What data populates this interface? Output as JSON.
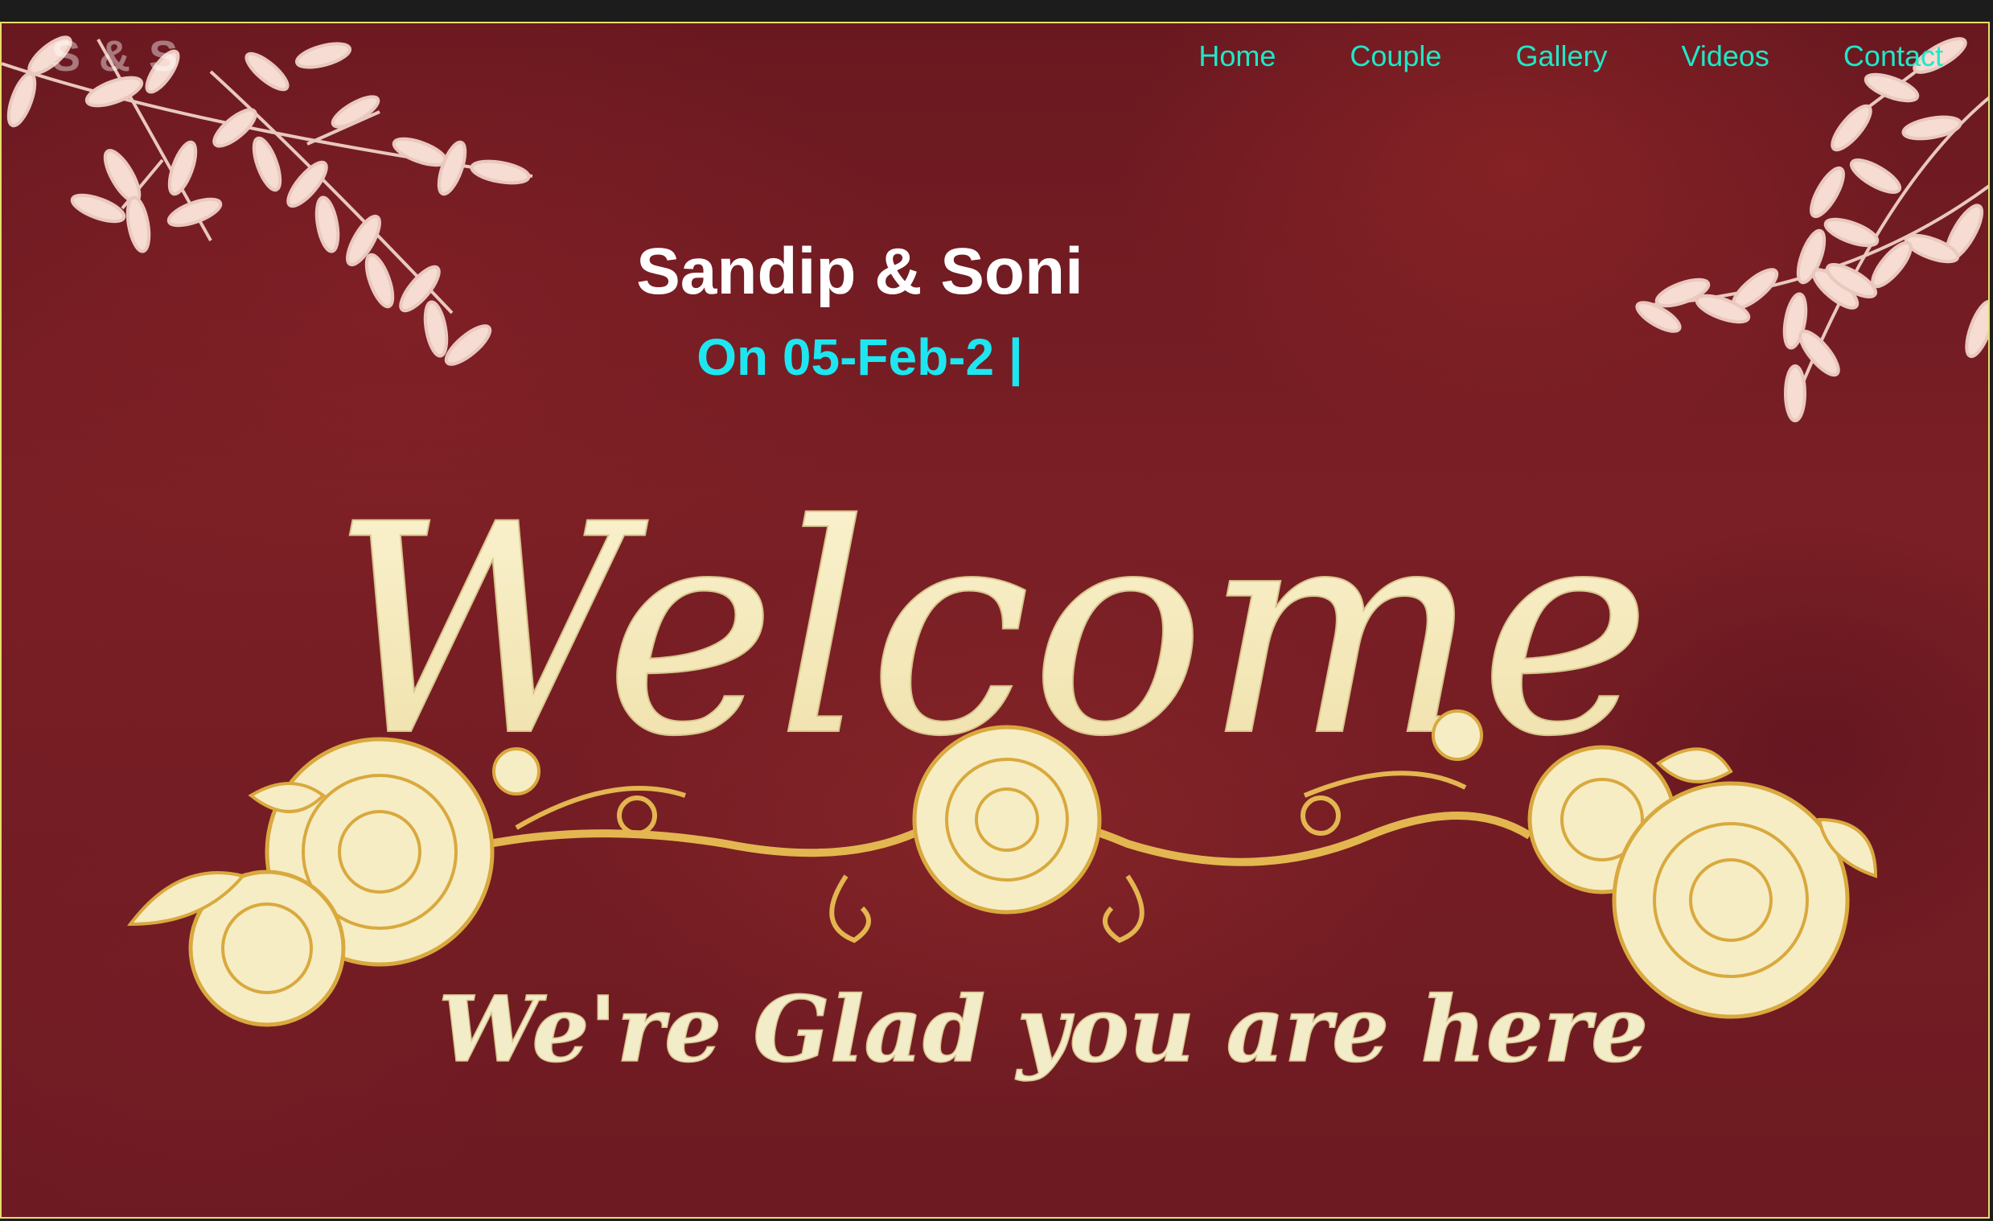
{
  "site": {
    "brand": "S & S"
  },
  "nav": {
    "items": [
      "Home",
      "Couple",
      "Gallery",
      "Videos",
      "Contact"
    ]
  },
  "hero": {
    "title": "Sandip & Soni",
    "subtitle": "On 05-Feb-2 |",
    "banner_heading": "Welcome",
    "banner_tagline": "We're Glad you are here"
  },
  "colors": {
    "nav_link": "#1ee8c8",
    "subtitle": "#1ee6f0",
    "background": "#6e1a22",
    "gold": "#e8c877",
    "cream": "#f3ecc8"
  }
}
